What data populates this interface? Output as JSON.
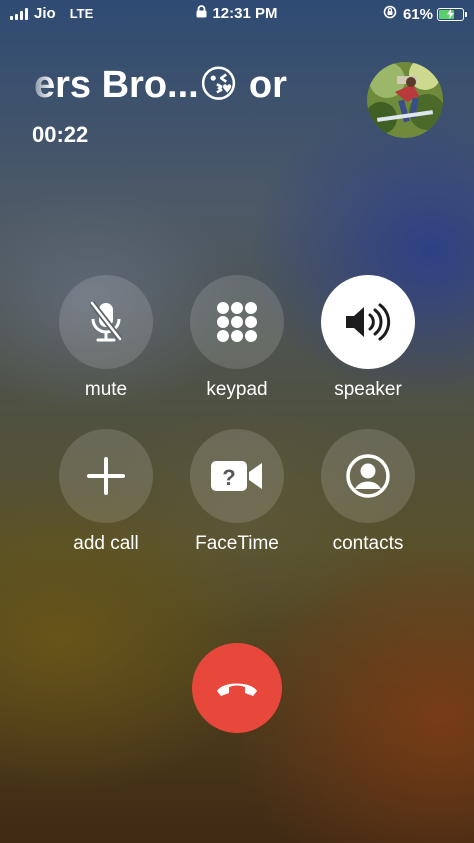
{
  "status_bar": {
    "carrier": "Jio",
    "network": "LTE",
    "time": "12:31 PM",
    "battery_percent": "61%",
    "battery_level": 0.61
  },
  "call": {
    "caller_name": "ers    Bro...😘 or",
    "timer": "00:22"
  },
  "controls": {
    "mute": "mute",
    "keypad": "keypad",
    "speaker": "speaker",
    "add_call": "add call",
    "facetime": "FaceTime",
    "contacts": "contacts"
  },
  "colors": {
    "end_call": "#e8473c",
    "active_button": "#ffffff",
    "battery_fill": "#5ad16a"
  },
  "icons": {
    "mute": "mic-slash-icon",
    "keypad": "keypad-grid-icon",
    "speaker": "speaker-wave-icon",
    "add_call": "plus-icon",
    "facetime": "video-question-icon",
    "contacts": "person-circle-icon",
    "end_call": "phone-hangup-icon"
  },
  "speaker_active": true
}
